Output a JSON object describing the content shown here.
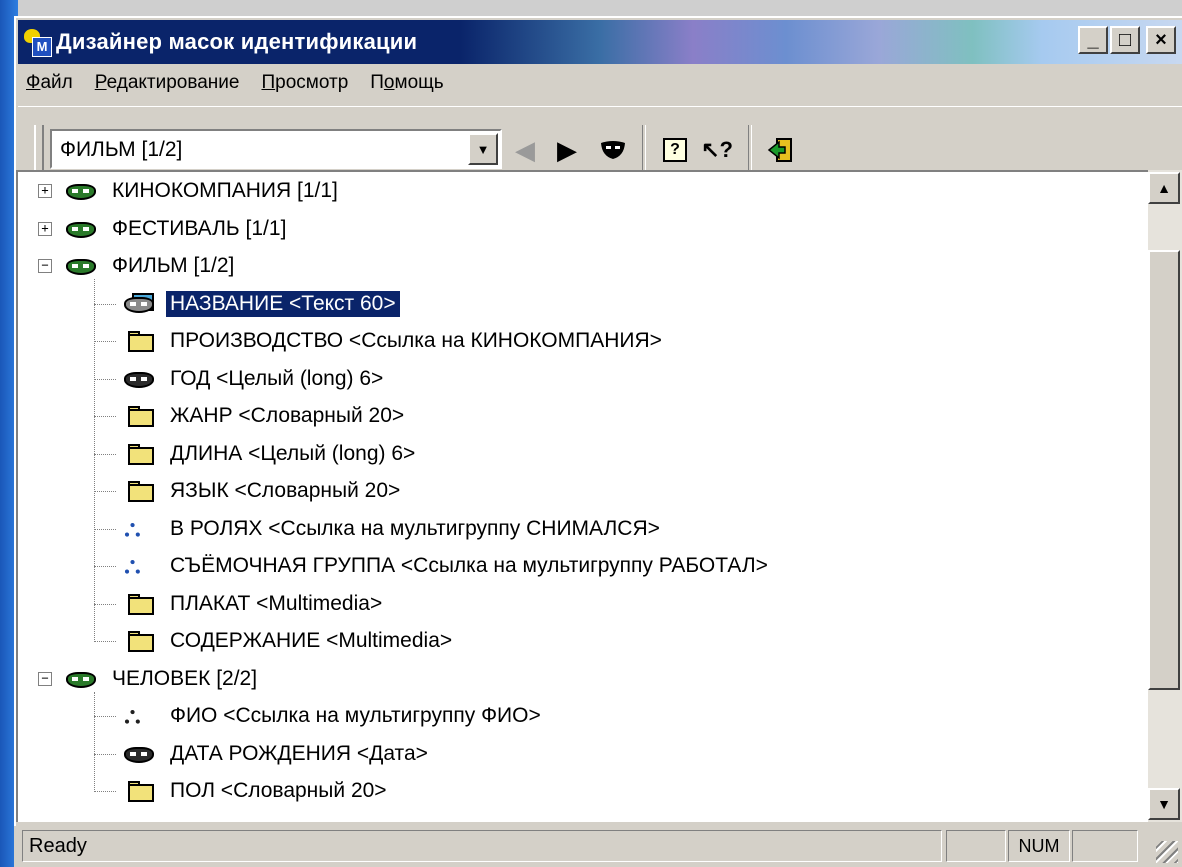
{
  "window": {
    "title": "Дизайнер масок идентификации",
    "controls": {
      "minimize": "_",
      "maximize": "□",
      "close": "×"
    }
  },
  "menu": [
    {
      "pre": "",
      "u": "Ф",
      "post": "айл"
    },
    {
      "pre": "",
      "u": "Р",
      "post": "едактирование"
    },
    {
      "pre": "",
      "u": "П",
      "post": "росмотр"
    },
    {
      "pre": "П",
      "u": "о",
      "post": "мощь"
    }
  ],
  "toolbar": {
    "combo_value": "ФИЛЬМ [1/2]",
    "buttons": {
      "back": "◀",
      "forward": "▶",
      "mask": "mask-icon",
      "help": "?",
      "context_help": "↖?",
      "exit": "exit-icon"
    }
  },
  "tree": {
    "roots": [
      {
        "label": "КИНОКОМПАНИЯ [1/1]",
        "expander": "+",
        "icon": "mask-green"
      },
      {
        "label": "ФЕСТИВАЛЬ [1/1]",
        "expander": "+",
        "icon": "mask-green"
      },
      {
        "label": "ФИЛЬМ [1/2]",
        "expander": "−",
        "icon": "mask-green",
        "children": [
          {
            "label": "НАЗВАНИЕ <Текст 60>",
            "icon": "mask-field",
            "selected": true
          },
          {
            "label": "ПРОИЗВОДСТВО  <Ссылка на КИНОКОМПАНИЯ>",
            "icon": "folder"
          },
          {
            "label": "ГОД <Целый (long) 6>",
            "icon": "mask-dark"
          },
          {
            "label": "ЖАНР  <Словарный 20>",
            "icon": "folder"
          },
          {
            "label": "ДЛИНА <Целый (long) 6>",
            "icon": "folder"
          },
          {
            "label": "ЯЗЫК  <Словарный 20>",
            "icon": "folder"
          },
          {
            "label": "В РОЛЯХ  <Ссылка на мультигруппу СНИМАЛСЯ>",
            "icon": "multigroup"
          },
          {
            "label": "СЪЁМОЧНАЯ ГРУППА  <Ссылка на мультигруппу РАБОТАЛ>",
            "icon": "multigroup"
          },
          {
            "label": "ПЛАКАТ <Multimedia>",
            "icon": "folder"
          },
          {
            "label": "СОДЕРЖАНИЕ <Multimedia>",
            "icon": "folder"
          }
        ]
      },
      {
        "label": "ЧЕЛОВЕК [2/2]",
        "expander": "−",
        "icon": "mask-green",
        "children": [
          {
            "label": "ФИО  <Ссылка на мультигруппу ФИО>",
            "icon": "multigroup-dark"
          },
          {
            "label": "ДАТА РОЖДЕНИЯ <Дата>",
            "icon": "mask-dark"
          },
          {
            "label": "ПОЛ  <Словарный 20>",
            "icon": "folder"
          }
        ]
      }
    ]
  },
  "status": {
    "text": "Ready",
    "num": "NUM"
  },
  "colors": {
    "selection": "#0a246a",
    "title_start": "#0a246a",
    "face": "#d4d0c8"
  }
}
